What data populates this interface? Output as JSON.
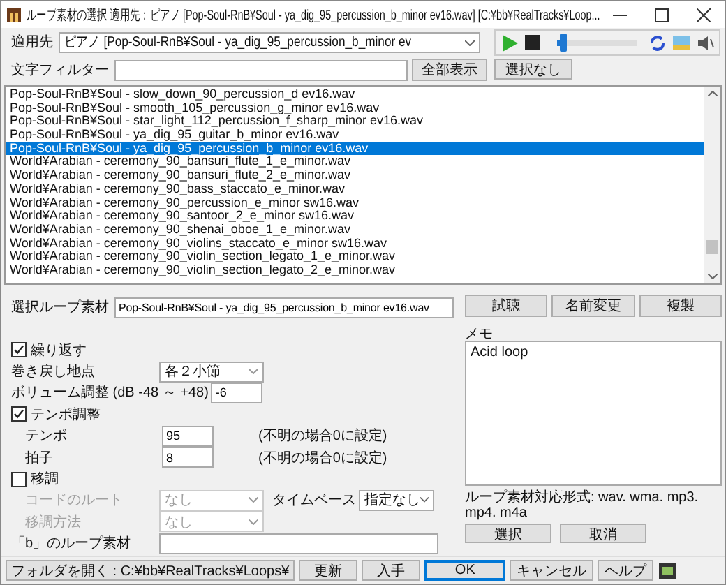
{
  "window": {
    "title": "ループ素材の選択  適用先：ピアノ   [Pop-Soul-RnB¥Soul - ya_dig_95_percussion_b_minor ev16.wav] [C:¥bb¥RealTracks¥Loop..."
  },
  "target": {
    "label": "適用先",
    "value": "ピアノ   [Pop-Soul-RnB¥Soul - ya_dig_95_percussion_b_minor ev"
  },
  "player": {
    "level": 0.03
  },
  "filter": {
    "label": "文字フィルター",
    "button": "全部表示"
  },
  "deselect_button": "選択なし",
  "files": [
    {
      "name": "Pop-Soul-RnB¥Soul - slow_down_90_percussion_d ev16.wav",
      "selected": false
    },
    {
      "name": "Pop-Soul-RnB¥Soul - smooth_105_percussion_g_minor ev16.wav",
      "selected": false
    },
    {
      "name": "Pop-Soul-RnB¥Soul - star_light_112_percussion_f_sharp_minor ev16.wav",
      "selected": false
    },
    {
      "name": "Pop-Soul-RnB¥Soul - ya_dig_95_guitar_b_minor ev16.wav",
      "selected": false
    },
    {
      "name": "Pop-Soul-RnB¥Soul - ya_dig_95_percussion_b_minor ev16.wav",
      "selected": true
    },
    {
      "name": "World¥Arabian - ceremony_90_bansuri_flute_1_e_minor.wav",
      "selected": false
    },
    {
      "name": "World¥Arabian - ceremony_90_bansuri_flute_2_e_minor.wav",
      "selected": false
    },
    {
      "name": "World¥Arabian - ceremony_90_bass_staccato_e_minor.wav",
      "selected": false
    },
    {
      "name": "World¥Arabian - ceremony_90_percussion_e_minor sw16.wav",
      "selected": false
    },
    {
      "name": "World¥Arabian - ceremony_90_santoor_2_e_minor sw16.wav",
      "selected": false
    },
    {
      "name": "World¥Arabian - ceremony_90_shenai_oboe_1_e_minor.wav",
      "selected": false
    },
    {
      "name": "World¥Arabian - ceremony_90_violins_staccato_e_minor sw16.wav",
      "selected": false
    },
    {
      "name": "World¥Arabian - ceremony_90_violin_section_legato_1_e_minor.wav",
      "selected": false
    },
    {
      "name": "World¥Arabian - ceremony_90_violin_section_legato_2_e_minor.wav",
      "selected": false
    }
  ],
  "selected_loop": {
    "label": "選択ループ素材",
    "value": "Pop-Soul-RnB¥Soul - ya_dig_95_percussion_b_minor ev16.wav"
  },
  "action_buttons": [
    "試聴",
    "名前変更",
    "複製"
  ],
  "memo": {
    "label": "メモ",
    "value": "Acid loop"
  },
  "settings": [
    {
      "kind": "checkbox",
      "label": "繰り返す",
      "checked": true
    },
    {
      "kind": "select",
      "label": "巻き戻し地点",
      "value": "各２小節",
      "disabled": false
    },
    {
      "kind": "input",
      "label": "ボリューム調整 (dB  -48 ～ +48)",
      "value": "-6"
    },
    {
      "kind": "checkbox",
      "label": "テンポ調整",
      "checked": true,
      "children": [
        {
          "kind": "input",
          "label": "テンポ",
          "value": "95",
          "note": "(不明の場合0に設定)"
        },
        {
          "kind": "input",
          "label": "拍子",
          "value": "8",
          "note": "(不明の場合0に設定)"
        }
      ]
    },
    {
      "kind": "checkbox",
      "label": "移調",
      "checked": false,
      "children": [
        {
          "kind": "select",
          "label": "コードのルート",
          "value": "なし",
          "disabled": true,
          "extra": {
            "label": "タイムベース",
            "value": "指定なし"
          }
        },
        {
          "kind": "select",
          "label": "移調方法",
          "value": "なし",
          "disabled": true
        }
      ]
    },
    {
      "kind": "path",
      "label": "「b」のループ素材"
    }
  ],
  "formats": "ループ素材対応形式: wav. wma. mp3. mp4. m4a",
  "format_buttons": [
    "選択",
    "取消"
  ],
  "footer_buttons": [
    {
      "label": "フォルダを開く : C:¥bb¥RealTracks¥Loops¥",
      "default": false
    },
    {
      "label": "更新",
      "default": false
    },
    {
      "label": "入手",
      "default": false
    },
    {
      "label": "OK",
      "default": true
    },
    {
      "label": "キャンセル",
      "default": false
    },
    {
      "label": "ヘルプ",
      "default": false
    }
  ]
}
